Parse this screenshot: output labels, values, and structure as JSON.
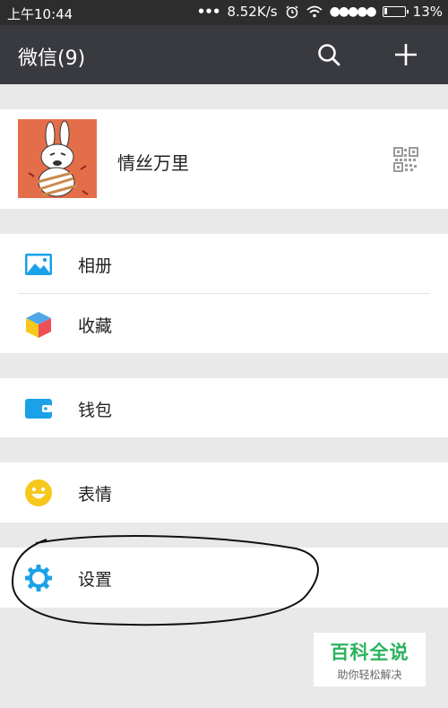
{
  "status_bar": {
    "time": "上午10:44",
    "network_speed": "8.52K/s",
    "battery_percent": "13%",
    "battery_level": 0.13
  },
  "header": {
    "title": "微信(9)",
    "icons": [
      "search-icon",
      "plus-icon"
    ]
  },
  "profile": {
    "name": "情丝万里",
    "avatar": "rabbit-avatar",
    "qr_icon": "qr-code-icon"
  },
  "menu": {
    "album": {
      "label": "相册",
      "icon": "album-icon"
    },
    "favorites": {
      "label": "收藏",
      "icon": "favorites-cube-icon"
    },
    "wallet": {
      "label": "钱包",
      "icon": "wallet-icon"
    },
    "stickers": {
      "label": "表情",
      "icon": "smiley-icon"
    },
    "settings": {
      "label": "设置",
      "icon": "gear-icon"
    }
  },
  "watermark": {
    "title": "百科全说",
    "subtitle": "助你轻松解决"
  },
  "colors": {
    "header_bg": "#393a3f",
    "page_bg": "#e9e9e9",
    "icon_blue": "#1aa1e8",
    "icon_yellow": "#f6c81b",
    "watermark_green": "#2bb35e"
  }
}
